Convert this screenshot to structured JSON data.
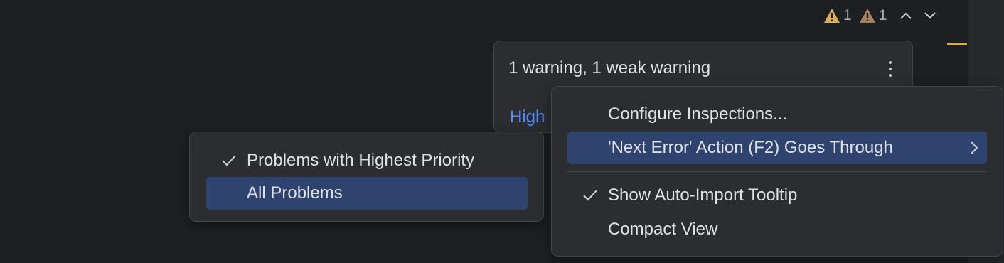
{
  "widget": {
    "warning_count": "1",
    "weak_warning_count": "1"
  },
  "tooltip": {
    "message": "1 warning, 1 weak warning",
    "link_text": "High"
  },
  "left_menu": {
    "items": [
      {
        "label": "Problems with Highest Priority",
        "checked": true
      },
      {
        "label": "All Problems",
        "checked": false
      }
    ]
  },
  "right_menu": {
    "items": [
      {
        "label": "Configure Inspections...",
        "checked": false
      },
      {
        "label": "'Next Error' Action (F2) Goes Through",
        "checked": false
      },
      {
        "label": "Show Auto-Import Tooltip",
        "checked": true
      },
      {
        "label": "Compact View",
        "checked": false
      }
    ]
  },
  "colors": {
    "background": "#1e1f22",
    "popup": "#2b2d30",
    "selection": "#2e436e",
    "link": "#548af7",
    "warning": "#d6ae58"
  }
}
